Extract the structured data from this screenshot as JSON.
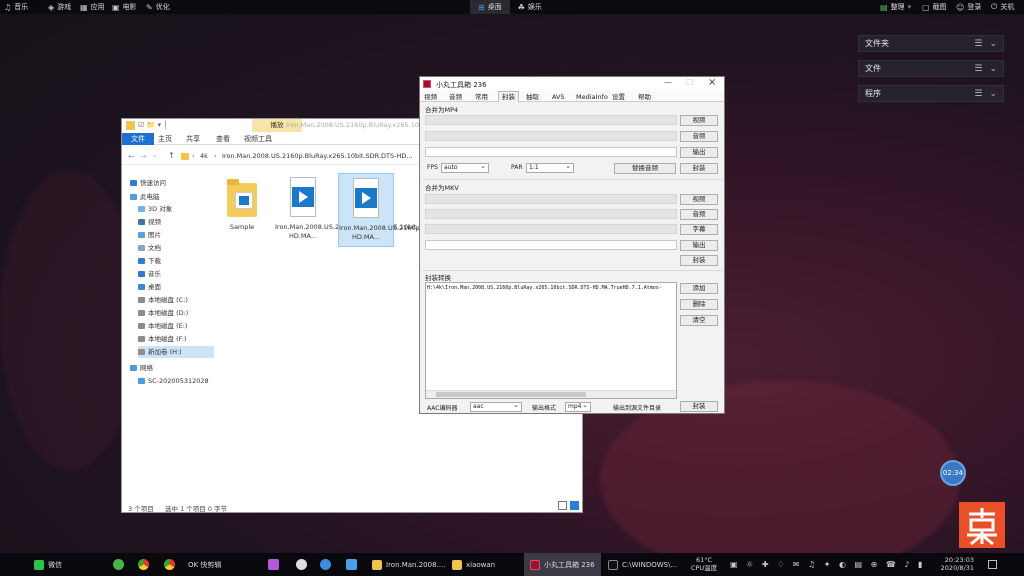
{
  "topbar": {
    "left_items": [
      {
        "icon": "music-icon",
        "label": "音乐"
      },
      {
        "icon": "gamepad-icon",
        "label": "游戏"
      },
      {
        "icon": "apps-icon",
        "label": "应用"
      },
      {
        "icon": "tv-icon",
        "label": "电影"
      },
      {
        "icon": "optimize-icon",
        "label": "优化"
      }
    ],
    "center_items": [
      {
        "icon": "desktop-icon",
        "label": "桌面"
      },
      {
        "icon": "entertainment-icon",
        "label": "娱乐"
      }
    ],
    "right_items": [
      {
        "icon": "organize-icon",
        "label": "整理"
      },
      {
        "icon": "screenshot-icon",
        "label": "截图"
      },
      {
        "icon": "login-icon",
        "label": "登录"
      },
      {
        "icon": "power-icon",
        "label": "关机"
      }
    ]
  },
  "widgets": [
    {
      "label": "文件夹"
    },
    {
      "label": "文件"
    },
    {
      "label": "程序"
    }
  ],
  "explorer": {
    "ribbon_tab_context": "播放",
    "title_path": "Iron.Man.2008.US.2160p.BluRay.x265.10bit.",
    "tabs": [
      "文件",
      "主页",
      "共享",
      "查看",
      "视频工具"
    ],
    "address": [
      "4k",
      "Iron.Man.2008.US.2160p.BluRay.x265.10bit.SDR.DTS-HD..."
    ],
    "nav": [
      {
        "label": "快速访问",
        "icon": "star-icon"
      },
      {
        "label": "此电脑",
        "icon": "computer-icon"
      },
      {
        "label": "3D 对象",
        "icon": "cube-icon"
      },
      {
        "label": "视频",
        "icon": "video-icon"
      },
      {
        "label": "图片",
        "icon": "picture-icon"
      },
      {
        "label": "文档",
        "icon": "document-icon"
      },
      {
        "label": "下载",
        "icon": "download-icon"
      },
      {
        "label": "音乐",
        "icon": "music-icon"
      },
      {
        "label": "桌面",
        "icon": "desktop-icon"
      },
      {
        "label": "本地磁盘 (C:)",
        "icon": "drive-icon"
      },
      {
        "label": "本地磁盘 (D:)",
        "icon": "drive-icon"
      },
      {
        "label": "本地磁盘 (E:)",
        "icon": "drive-icon"
      },
      {
        "label": "本地磁盘 (F:)",
        "icon": "drive-icon"
      },
      {
        "label": "新加卷 (H:)",
        "icon": "drive-icon"
      },
      {
        "label": "网络",
        "icon": "network-icon"
      },
      {
        "label": "SC-202005312028",
        "icon": "computer-icon"
      }
    ],
    "files": [
      {
        "name": "Sample",
        "type": "folder"
      },
      {
        "name": "Iron.Man.2008.US.2160p.BluRay.x265.10bit.SDR.DTS-HD.MA...",
        "type": "video"
      },
      {
        "name": "Iron.Man.2008.US.2160p.BluRay.x265.10bit.SDR.DTS-HD.MA...",
        "type": "video",
        "selected": true
      }
    ],
    "status_items": "3 个项目",
    "status_selected": "选中 1 个项目 0 字节"
  },
  "tool": {
    "title": "小丸工具箱 236",
    "tabs": [
      "视频",
      "音频",
      "常用",
      "封装",
      "抽取",
      "AVS",
      "MediaInfo",
      "设置",
      "帮助"
    ],
    "active_tab": "封装",
    "mp4": {
      "section": "合并为MP4",
      "buttons": [
        "视频",
        "音频",
        "输出",
        "封装"
      ],
      "fps_label": "FPS",
      "fps_value": "auto",
      "par_label": "PAR",
      "par_value": "1:1",
      "replace_audio": "替换音频"
    },
    "mkv": {
      "section": "合并为MKV",
      "buttons": [
        "视频",
        "音频",
        "字幕",
        "输出",
        "封装"
      ]
    },
    "convert": {
      "section": "封装转换",
      "list_item": "H:\\4k\\Iron.Man.2008.US.2160p.BluRay.x265.10bit.SDR.DTS-HD.MA.TrueHD.7.1.Atmos-",
      "buttons": [
        "添加",
        "删除",
        "清空"
      ],
      "aac_label": "AAC编码器",
      "aac_value": "aac",
      "out_format_label": "输出格式",
      "out_format_value": "mp4",
      "out_to_source": "输出到源文件目录",
      "mux_button": "封装"
    }
  },
  "desktop_badge": "02:34",
  "taskbar": {
    "items": [
      {
        "label": "微信",
        "icon": "wechat-icon"
      },
      {
        "label": "OK 快剪辑",
        "icon": "video-editor-icon"
      },
      {
        "label": "Iron.Man.2008....",
        "icon": "folder-icon"
      },
      {
        "label": "xiaowan",
        "icon": "folder-icon"
      },
      {
        "label": "小丸工具箱 236",
        "icon": "toolbox-icon",
        "active": true
      },
      {
        "label": "C:\\WINDOWS\\...",
        "icon": "terminal-icon"
      }
    ],
    "temp": "61°C",
    "temp_label": "CPU温度",
    "time": "20:23:03",
    "date": "2020/8/31"
  }
}
